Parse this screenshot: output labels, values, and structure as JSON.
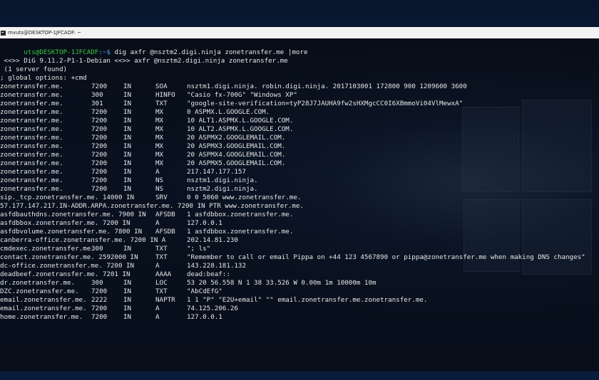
{
  "window": {
    "title": "mvuts@DESKTOP-1JFCADF: ~"
  },
  "prompt": {
    "user_host": "uts@DESKTOP-1JFCADF",
    "path": ":~$",
    "command": " dig axfr @nsztm2.digi.ninja zonetransfer.me |more"
  },
  "header": [
    " <<>> DiG 9.11.2-P1-1-Debian <<>> axfr @nsztm2.digi.ninja zonetransfer.me",
    " (1 server found)",
    "; global options: +cmd"
  ],
  "records": [
    {
      "name": "zonetransfer.me.",
      "ttl": "7200",
      "cls": "IN",
      "type": "SOA",
      "data": "nsztm1.digi.ninja. robin.digi.ninja. 2017103001 172800 900 1209600 3600"
    },
    {
      "name": "zonetransfer.me.",
      "ttl": "300",
      "cls": "IN",
      "type": "HINFO",
      "data": "\"Casio fx-700G\" \"Windows XP\""
    },
    {
      "name": "zonetransfer.me.",
      "ttl": "301",
      "cls": "IN",
      "type": "TXT",
      "data": "\"google-site-verification=tyP28J7JAUHA9fw2sHXMgcCC0I6XBmmoVi04VlMewxA\""
    },
    {
      "name": "zonetransfer.me.",
      "ttl": "7200",
      "cls": "IN",
      "type": "MX",
      "data": "0 ASPMX.L.GOOGLE.COM."
    },
    {
      "name": "zonetransfer.me.",
      "ttl": "7200",
      "cls": "IN",
      "type": "MX",
      "data": "10 ALT1.ASPMX.L.GOOGLE.COM."
    },
    {
      "name": "zonetransfer.me.",
      "ttl": "7200",
      "cls": "IN",
      "type": "MX",
      "data": "10 ALT2.ASPMX.L.GOOGLE.COM."
    },
    {
      "name": "zonetransfer.me.",
      "ttl": "7200",
      "cls": "IN",
      "type": "MX",
      "data": "20 ASPMX2.GOOGLEMAIL.COM."
    },
    {
      "name": "zonetransfer.me.",
      "ttl": "7200",
      "cls": "IN",
      "type": "MX",
      "data": "20 ASPMX3.GOOGLEMAIL.COM."
    },
    {
      "name": "zonetransfer.me.",
      "ttl": "7200",
      "cls": "IN",
      "type": "MX",
      "data": "20 ASPMX4.GOOGLEMAIL.COM."
    },
    {
      "name": "zonetransfer.me.",
      "ttl": "7200",
      "cls": "IN",
      "type": "MX",
      "data": "20 ASPMX5.GOOGLEMAIL.COM."
    },
    {
      "name": "zonetransfer.me.",
      "ttl": "7200",
      "cls": "IN",
      "type": "A",
      "data": "217.147.177.157"
    },
    {
      "name": "zonetransfer.me.",
      "ttl": "7200",
      "cls": "IN",
      "type": "NS",
      "data": "nsztm1.digi.ninja."
    },
    {
      "name": "zonetransfer.me.",
      "ttl": "7200",
      "cls": "IN",
      "type": "NS",
      "data": "nsztm2.digi.ninja."
    },
    {
      "name": "sip._tcp.zonetransfer.me. 14000 IN",
      "ttl": "",
      "cls": "",
      "type": "SRV",
      "data": "0 0 5060 www.zonetransfer.me."
    },
    {
      "name": "57.177.147.217.IN-ADDR.ARPA.zonetransfer.me. 7200 IN PTR www.zonetransfer.me.",
      "ttl": "",
      "cls": "",
      "type": "",
      "data": ""
    },
    {
      "name": "asfdbauthdns.zonetransfer.me. 7900 IN",
      "ttl": "",
      "cls": "",
      "type": "AFSDB",
      "data": "1 asfdbbox.zonetransfer.me."
    },
    {
      "name": "asfdbbox.zonetransfer.me. 7200 IN",
      "ttl": "",
      "cls": "",
      "type": "A",
      "data": "127.0.0.1"
    },
    {
      "name": "asfdbvolume.zonetransfer.me. 7800 IN",
      "ttl": "",
      "cls": "",
      "type": "AFSDB",
      "data": "1 asfdbbox.zonetransfer.me."
    },
    {
      "name": "canberra-office.zonetransfer.me. 7200 IN A",
      "ttl": "",
      "cls": "",
      "type": "",
      "data": "202.14.81.230"
    },
    {
      "name": "cmdexec.zonetransfer.me.",
      "ttl": "300",
      "cls": "IN",
      "type": "TXT",
      "data": "\"; ls\""
    },
    {
      "name": "contact.zonetransfer.me. 2592000 IN",
      "ttl": "",
      "cls": "",
      "type": "TXT",
      "data": "\"Remember to call or email Pippa on +44 123 4567890 or pippa@zonetransfer.me when making DNS changes\""
    },
    {
      "name": "dc-office.zonetransfer.me. 7200 IN",
      "ttl": "",
      "cls": "",
      "type": "A",
      "data": "143.228.181.132"
    },
    {
      "name": "deadbeef.zonetransfer.me. 7201 IN",
      "ttl": "",
      "cls": "",
      "type": "AAAA",
      "data": "dead:beaf::"
    },
    {
      "name": "dr.zonetransfer.me.",
      "ttl": "300",
      "cls": "IN",
      "type": "LOC",
      "data": "53 20 56.558 N 1 38 33.526 W 0.00m 1m 10000m 10m"
    },
    {
      "name": "DZC.zonetransfer.me.",
      "ttl": "7200",
      "cls": "IN",
      "type": "TXT",
      "data": "\"AbCdEfG\""
    },
    {
      "name": "email.zonetransfer.me.",
      "ttl": "2222",
      "cls": "IN",
      "type": "NAPTR",
      "data": "1 1 \"P\" \"E2U+email\" \"\" email.zonetransfer.me.zonetransfer.me."
    },
    {
      "name": "email.zonetransfer.me.",
      "ttl": "7200",
      "cls": "IN",
      "type": "A",
      "data": "74.125.206.26"
    },
    {
      "name": "home.zonetransfer.me.",
      "ttl": "7200",
      "cls": "IN",
      "type": "A",
      "data": "127.0.0.1"
    }
  ]
}
